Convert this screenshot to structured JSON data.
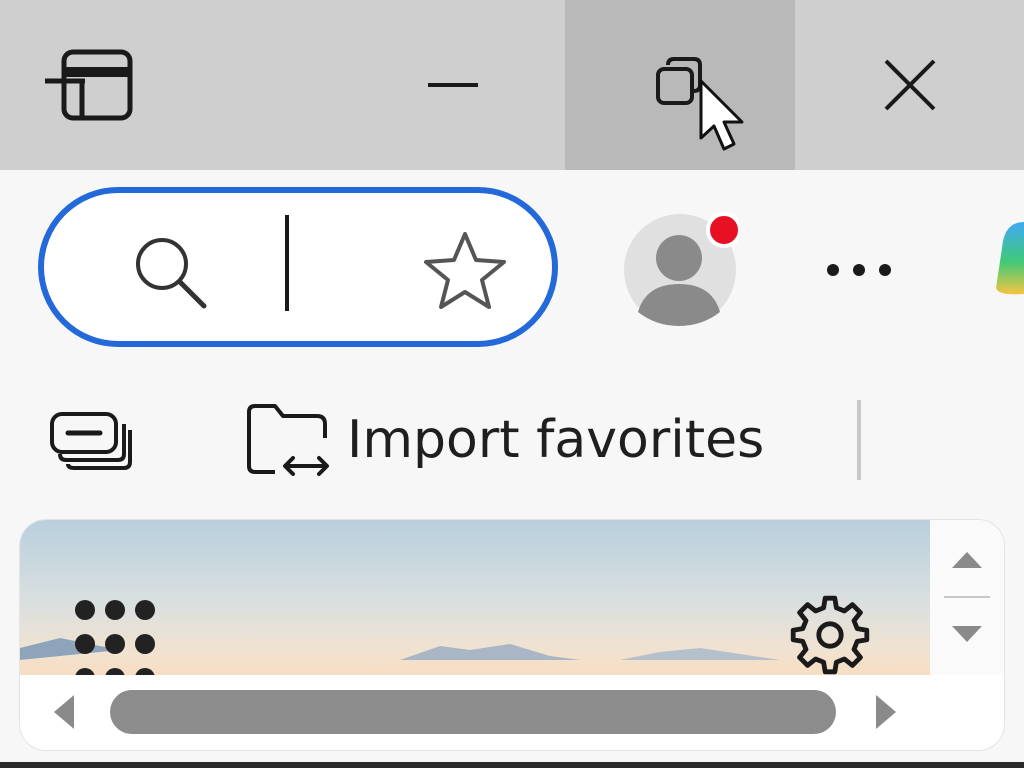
{
  "titlebar": {
    "tab_actions": "tab-actions",
    "minimize": "minimize",
    "restore": "restore",
    "close": "close"
  },
  "toolbar": {
    "search_icon": "search-icon",
    "favorite_icon": "star-icon",
    "profile_notification_color": "#e81123",
    "more_icon": "more-horizontal-icon",
    "accent_color": "#2469d9"
  },
  "favorites_bar": {
    "collections_icon": "collections-icon",
    "import_label": "Import favorites"
  },
  "panel": {
    "apps_icon": "app-launcher-icon",
    "settings_icon": "gear-icon"
  }
}
